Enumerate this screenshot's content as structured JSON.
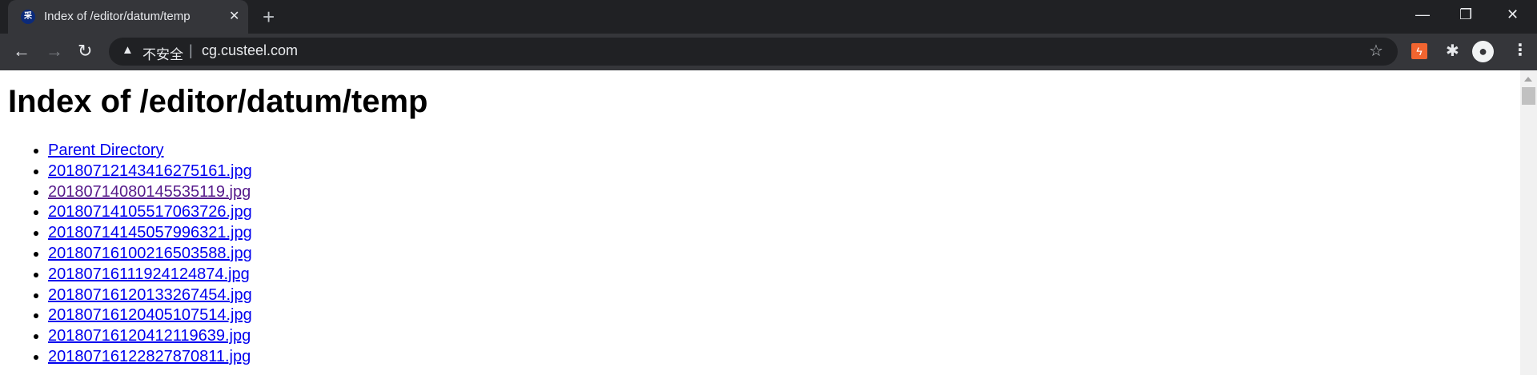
{
  "tab": {
    "favicon_text": "采",
    "title": "Index of /editor/datum/temp",
    "close": "✕",
    "new_tab": "+"
  },
  "window": {
    "minimize": "—",
    "restore": "❐",
    "close": "✕"
  },
  "toolbar": {
    "back": "←",
    "forward": "→",
    "reload": "↻",
    "warning": "▲",
    "insecure_label": "不安全",
    "separator": "|",
    "url": "cg.custeel.com",
    "star": "☆",
    "ext1": "ϟ",
    "extensions": "✱",
    "avatar": "●",
    "menu": "⋮"
  },
  "page": {
    "heading": "Index of /editor/datum/temp",
    "links": [
      {
        "label": "Parent Directory",
        "visited": false
      },
      {
        "label": "20180712143416275161.jpg",
        "visited": false
      },
      {
        "label": "20180714080145535119.jpg",
        "visited": true
      },
      {
        "label": "20180714105517063726.jpg",
        "visited": false
      },
      {
        "label": "20180714145057996321.jpg",
        "visited": false
      },
      {
        "label": "20180716100216503588.jpg",
        "visited": false
      },
      {
        "label": "20180716111924124874.jpg",
        "visited": false
      },
      {
        "label": "20180716120133267454.jpg",
        "visited": false
      },
      {
        "label": "20180716120405107514.jpg",
        "visited": false
      },
      {
        "label": "20180716120412119639.jpg",
        "visited": false
      },
      {
        "label": "20180716122827870811.jpg",
        "visited": false
      }
    ]
  }
}
